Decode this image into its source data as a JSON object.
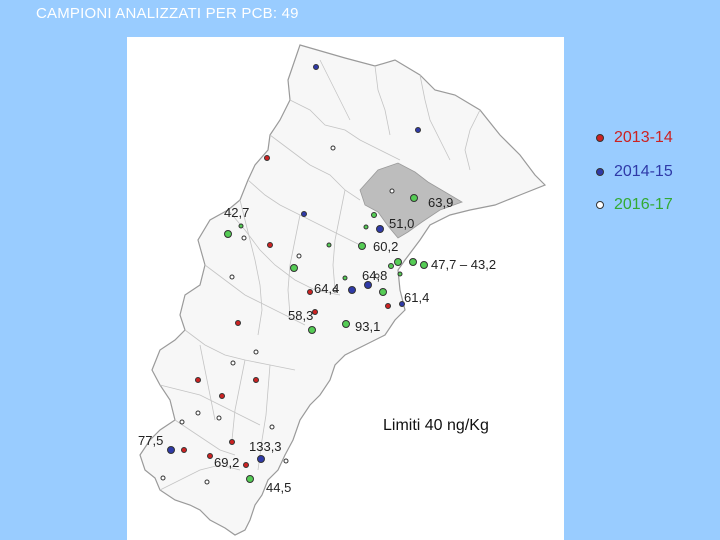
{
  "title": "CAMPIONI  ANALIZZATI PER PCB: 49",
  "legend": [
    {
      "label": "2013-14",
      "color": "#cc2222"
    },
    {
      "label": "2014-15",
      "color": "#2f3aa8"
    },
    {
      "label": "2016-17",
      "color": "#33aa33"
    }
  ],
  "labels": [
    "42,7",
    "63,9",
    "51,0",
    "60,2",
    "47,7 – 43,2",
    "64,4",
    "64,8",
    "61,4",
    "58,3",
    "93,1",
    "77,5",
    "133,3",
    "69,2",
    "44,5"
  ],
  "limit_text": "Limiti 40 ng/Kg"
}
